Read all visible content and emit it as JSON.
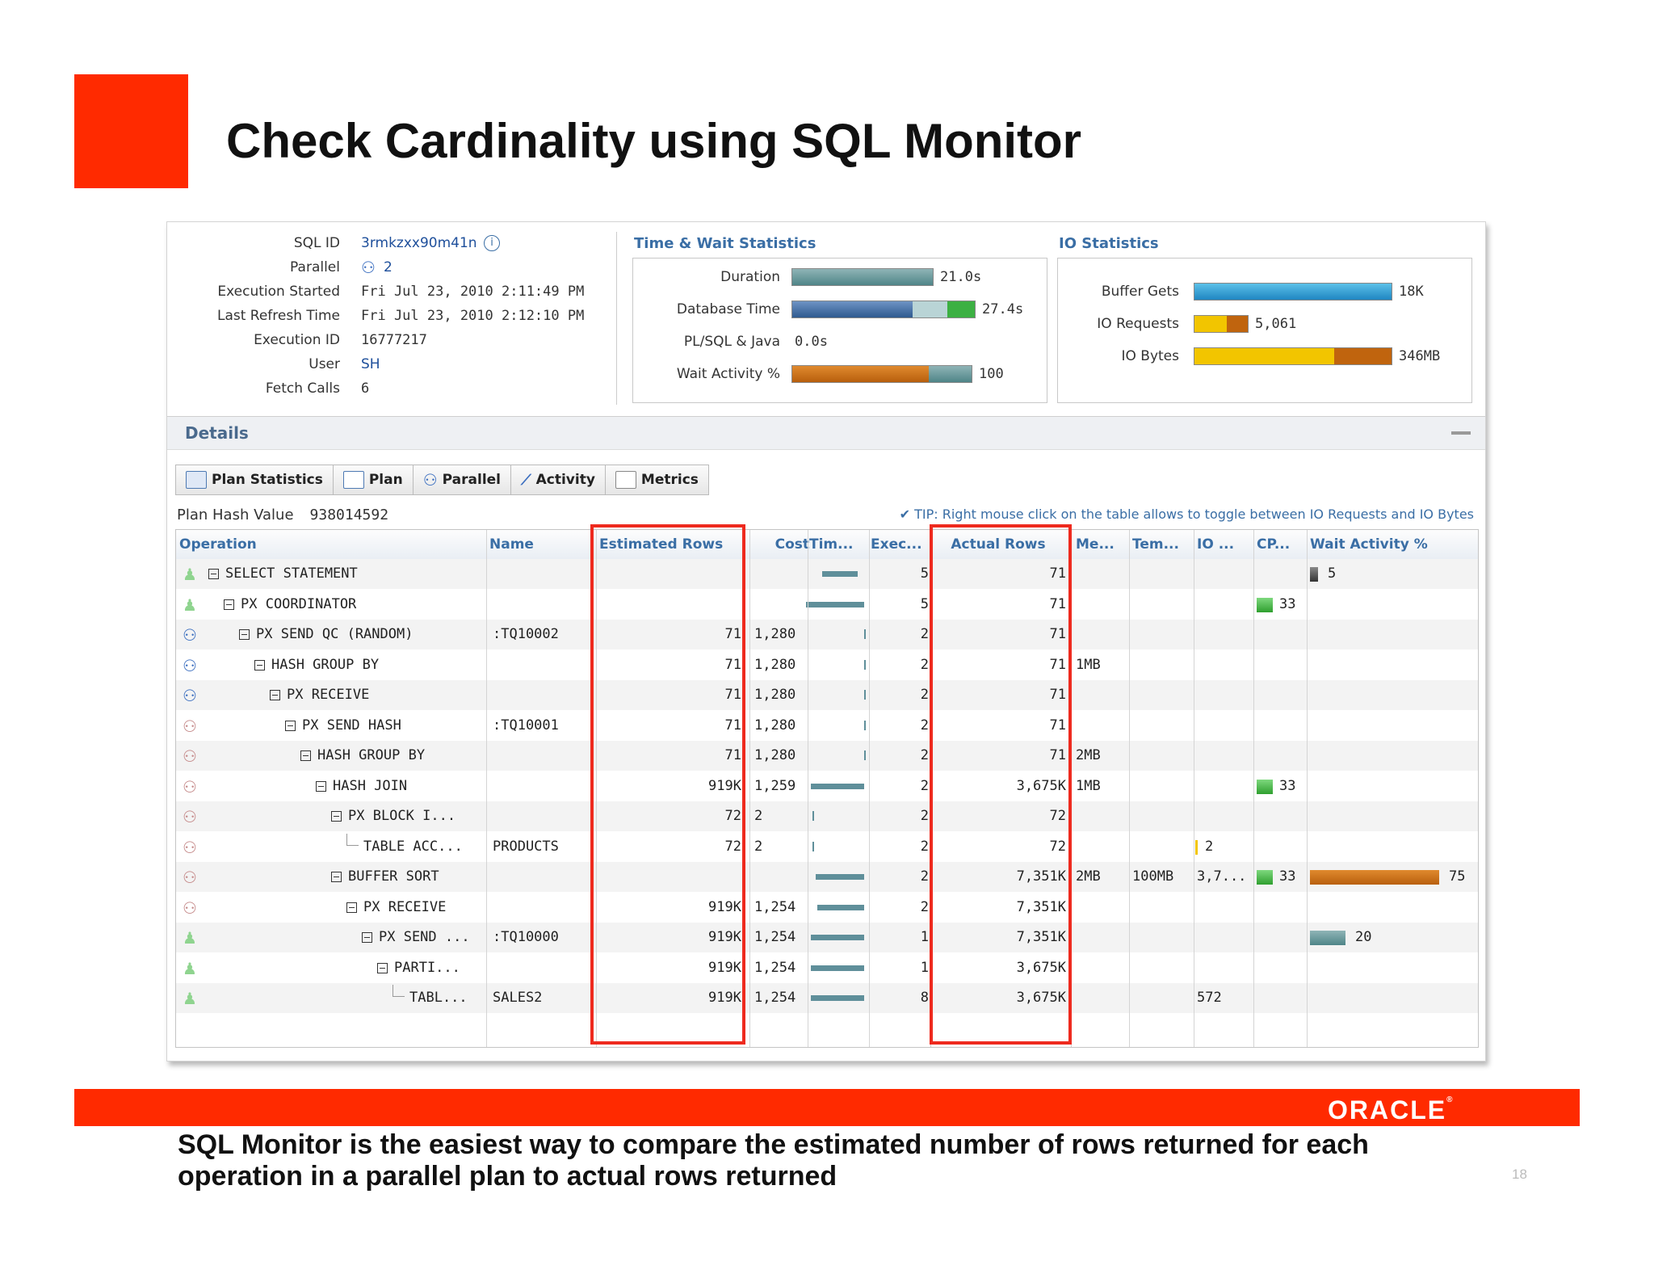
{
  "slide": {
    "title": "Check Cardinality using SQL Monitor",
    "caption": "SQL Monitor is the easiest way to compare the estimated number of rows returned for each operation in a parallel plan to actual rows returned",
    "page_number": "18",
    "brand": "ORACLE",
    "colors": {
      "accent_red": "#ff2a00",
      "highlight_box": "#ee2a1e",
      "header_blue": "#3a6ea5"
    }
  },
  "summary": {
    "sql_id": {
      "label": "SQL ID",
      "value": "3rmkzxx90m41n"
    },
    "parallel": {
      "label": "Parallel",
      "value": "2"
    },
    "execution_started": {
      "label": "Execution Started",
      "value": "Fri Jul 23, 2010 2:11:49 PM"
    },
    "last_refresh": {
      "label": "Last Refresh Time",
      "value": "Fri Jul 23, 2010 2:12:10 PM"
    },
    "execution_id": {
      "label": "Execution ID",
      "value": "16777217"
    },
    "user": {
      "label": "User",
      "value": "SH"
    },
    "fetch_calls": {
      "label": "Fetch Calls",
      "value": "6"
    }
  },
  "time_wait": {
    "title": "Time & Wait Statistics",
    "duration": {
      "label": "Duration",
      "value": "21.0s"
    },
    "db_time": {
      "label": "Database Time",
      "value": "27.4s"
    },
    "plsql": {
      "label": "PL/SQL & Java",
      "value": "0.0s"
    },
    "wait_activity": {
      "label": "Wait Activity %",
      "value": "100"
    }
  },
  "io_stats": {
    "title": "IO Statistics",
    "buffer_gets": {
      "label": "Buffer Gets",
      "value": "18K"
    },
    "io_requests": {
      "label": "IO Requests",
      "value": "5,061"
    },
    "io_bytes": {
      "label": "IO Bytes",
      "value": "346MB"
    }
  },
  "details": {
    "title": "Details",
    "tabs": [
      "Plan Statistics",
      "Plan",
      "Parallel",
      "Activity",
      "Metrics"
    ],
    "plan_hash_label": "Plan Hash Value",
    "plan_hash_value": "938014592",
    "tip": "TIP: Right mouse click on the table allows to toggle between IO Requests and IO Bytes"
  },
  "grid": {
    "columns": [
      "Operation",
      "Name",
      "Estimated Rows",
      "Cost",
      "Tim...",
      "Exec...",
      "Actual Rows",
      "Me...",
      "Tem...",
      "IO ...",
      "CP...",
      "Wait Activity %"
    ],
    "rows": [
      {
        "op": "SELECT STATEMENT",
        "name": "",
        "est": "",
        "cost": "",
        "exec": "5",
        "act": "71",
        "mem": "",
        "temp": "",
        "io": "",
        "cpu": "",
        "wait": "5"
      },
      {
        "op": "PX COORDINATOR",
        "name": "",
        "est": "",
        "cost": "",
        "exec": "5",
        "act": "71",
        "mem": "",
        "temp": "",
        "io": "",
        "cpu": "33",
        "wait": ""
      },
      {
        "op": "PX SEND QC (RANDOM)",
        "name": ":TQ10002",
        "est": "71",
        "cost": "1,280",
        "exec": "2",
        "act": "71",
        "mem": "",
        "temp": "",
        "io": "",
        "cpu": "",
        "wait": ""
      },
      {
        "op": "HASH GROUP BY",
        "name": "",
        "est": "71",
        "cost": "1,280",
        "exec": "2",
        "act": "71",
        "mem": "1MB",
        "temp": "",
        "io": "",
        "cpu": "",
        "wait": ""
      },
      {
        "op": "PX RECEIVE",
        "name": "",
        "est": "71",
        "cost": "1,280",
        "exec": "2",
        "act": "71",
        "mem": "",
        "temp": "",
        "io": "",
        "cpu": "",
        "wait": ""
      },
      {
        "op": "PX SEND HASH",
        "name": ":TQ10001",
        "est": "71",
        "cost": "1,280",
        "exec": "2",
        "act": "71",
        "mem": "",
        "temp": "",
        "io": "",
        "cpu": "",
        "wait": ""
      },
      {
        "op": "HASH GROUP BY",
        "name": "",
        "est": "71",
        "cost": "1,280",
        "exec": "2",
        "act": "71",
        "mem": "2MB",
        "temp": "",
        "io": "",
        "cpu": "",
        "wait": ""
      },
      {
        "op": "HASH JOIN",
        "name": "",
        "est": "919K",
        "cost": "1,259",
        "exec": "2",
        "act": "3,675K",
        "mem": "1MB",
        "temp": "",
        "io": "",
        "cpu": "33",
        "wait": ""
      },
      {
        "op": "PX BLOCK I...",
        "name": "",
        "est": "72",
        "cost": "2",
        "exec": "2",
        "act": "72",
        "mem": "",
        "temp": "",
        "io": "",
        "cpu": "",
        "wait": ""
      },
      {
        "op": "TABLE ACC...",
        "name": "PRODUCTS",
        "est": "72",
        "cost": "2",
        "exec": "2",
        "act": "72",
        "mem": "",
        "temp": "",
        "io": "2",
        "cpu": "",
        "wait": ""
      },
      {
        "op": "BUFFER SORT",
        "name": "",
        "est": "",
        "cost": "",
        "exec": "2",
        "act": "7,351K",
        "mem": "2MB",
        "temp": "100MB",
        "io": "3,7...",
        "cpu": "33",
        "wait": "75"
      },
      {
        "op": "PX RECEIVE",
        "name": "",
        "est": "919K",
        "cost": "1,254",
        "exec": "2",
        "act": "7,351K",
        "mem": "",
        "temp": "",
        "io": "",
        "cpu": "",
        "wait": ""
      },
      {
        "op": "PX SEND ...",
        "name": ":TQ10000",
        "est": "919K",
        "cost": "1,254",
        "exec": "1",
        "act": "7,351K",
        "mem": "",
        "temp": "",
        "io": "",
        "cpu": "",
        "wait": "20"
      },
      {
        "op": "PARTI...",
        "name": "",
        "est": "919K",
        "cost": "1,254",
        "exec": "1",
        "act": "3,675K",
        "mem": "",
        "temp": "",
        "io": "",
        "cpu": "",
        "wait": ""
      },
      {
        "op": "TABL...",
        "name": "SALES2",
        "est": "919K",
        "cost": "1,254",
        "exec": "8",
        "act": "3,675K",
        "mem": "",
        "temp": "",
        "io": "572",
        "cpu": "",
        "wait": ""
      }
    ]
  }
}
